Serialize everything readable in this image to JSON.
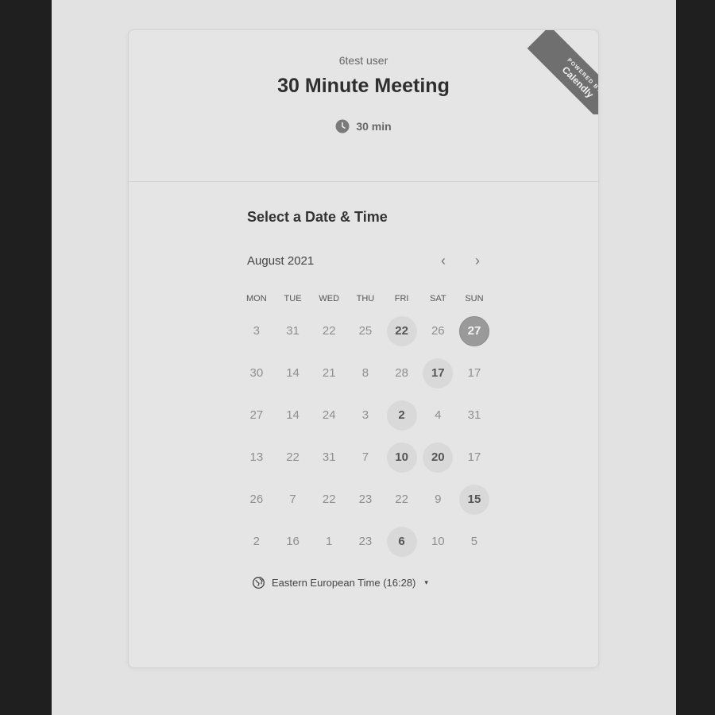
{
  "header": {
    "organizer": "6test user",
    "event_title": "30 Minute Meeting",
    "duration": "30 min",
    "ribbon_small": "POWERED BY",
    "ribbon_brand": "Calendly"
  },
  "calendar": {
    "section_title": "Select a Date & Time",
    "month": "August 2021",
    "prev_icon": "‹",
    "next_icon": "›",
    "weekdays": [
      "MON",
      "TUE",
      "WED",
      "THU",
      "FRI",
      "SAT",
      "SUN"
    ],
    "days": [
      {
        "label": "3",
        "state": "disabled"
      },
      {
        "label": "31",
        "state": "disabled"
      },
      {
        "label": "22",
        "state": "disabled"
      },
      {
        "label": "25",
        "state": "disabled"
      },
      {
        "label": "22",
        "state": "available"
      },
      {
        "label": "26",
        "state": "disabled"
      },
      {
        "label": "27",
        "state": "selected"
      },
      {
        "label": "30",
        "state": "disabled"
      },
      {
        "label": "14",
        "state": "disabled"
      },
      {
        "label": "21",
        "state": "disabled"
      },
      {
        "label": "8",
        "state": "disabled"
      },
      {
        "label": "28",
        "state": "disabled"
      },
      {
        "label": "17",
        "state": "available"
      },
      {
        "label": "17",
        "state": "disabled"
      },
      {
        "label": "27",
        "state": "disabled"
      },
      {
        "label": "14",
        "state": "disabled"
      },
      {
        "label": "24",
        "state": "disabled"
      },
      {
        "label": "3",
        "state": "disabled"
      },
      {
        "label": "2",
        "state": "available"
      },
      {
        "label": "4",
        "state": "disabled"
      },
      {
        "label": "31",
        "state": "disabled"
      },
      {
        "label": "13",
        "state": "disabled"
      },
      {
        "label": "22",
        "state": "disabled"
      },
      {
        "label": "31",
        "state": "disabled"
      },
      {
        "label": "7",
        "state": "disabled"
      },
      {
        "label": "10",
        "state": "available"
      },
      {
        "label": "20",
        "state": "available"
      },
      {
        "label": "17",
        "state": "disabled"
      },
      {
        "label": "26",
        "state": "disabled"
      },
      {
        "label": "7",
        "state": "disabled"
      },
      {
        "label": "22",
        "state": "disabled"
      },
      {
        "label": "23",
        "state": "disabled"
      },
      {
        "label": "22",
        "state": "disabled"
      },
      {
        "label": "9",
        "state": "disabled"
      },
      {
        "label": "15",
        "state": "available"
      },
      {
        "label": "2",
        "state": "disabled"
      },
      {
        "label": "16",
        "state": "disabled"
      },
      {
        "label": "1",
        "state": "disabled"
      },
      {
        "label": "23",
        "state": "disabled"
      },
      {
        "label": "6",
        "state": "available"
      },
      {
        "label": "10",
        "state": "disabled"
      },
      {
        "label": "5",
        "state": "disabled"
      }
    ]
  },
  "timezone": {
    "label": "Eastern European Time (16:28)",
    "caret": "▾"
  }
}
